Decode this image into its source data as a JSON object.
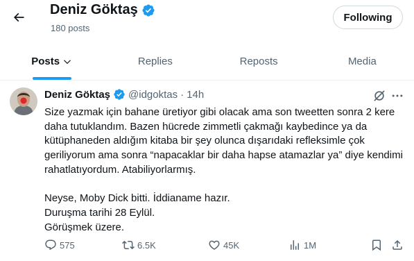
{
  "header": {
    "name": "Deniz Göktaş",
    "posts_count": "180 posts",
    "follow_label": "Following"
  },
  "tabs": [
    {
      "label": "Posts",
      "active": true
    },
    {
      "label": "Replies",
      "active": false
    },
    {
      "label": "Reposts",
      "active": false
    },
    {
      "label": "Media",
      "active": false
    }
  ],
  "tweet": {
    "name": "Deniz Göktaş",
    "handle": "@idgoktas",
    "separator": "·",
    "time": "14h",
    "text": "Size yazmak için bahane üretiyor gibi olacak ama son tweetten sonra 2 kere daha tutuklandım. Bazen hücrede zimmetli çakmağı kaybedince ya da kütüphaneden aldığım kitaba bir şey olunca dışarıdaki refleksimle çok geriliyorum ama sonra “napacaklar bir daha hapse atamazlar ya” diye kendimi rahatlatıyordum. Atabiliyorlarmış.\n\nNeyse, Moby Dick bitti. İddianame hazır.\nDuruşma tarihi 28 Eylül.\nGörüşmek üzere.",
    "replies": "575",
    "reposts": "6.5K",
    "likes": "45K",
    "views": "1M"
  },
  "colors": {
    "accent": "#1d9bf0",
    "secondary_text": "#536471",
    "primary_text": "#0f1419",
    "border": "#eff3f4"
  },
  "icons": {
    "back": "arrow-left-icon",
    "verified": "verified-badge-icon",
    "tab_dropdown": "chevron-down-icon",
    "grok": "grok-icon",
    "more": "more-horizontal-icon",
    "reply": "reply-icon",
    "repost": "repost-icon",
    "like": "heart-icon",
    "views": "views-chart-icon",
    "bookmark": "bookmark-icon",
    "share": "share-icon"
  }
}
